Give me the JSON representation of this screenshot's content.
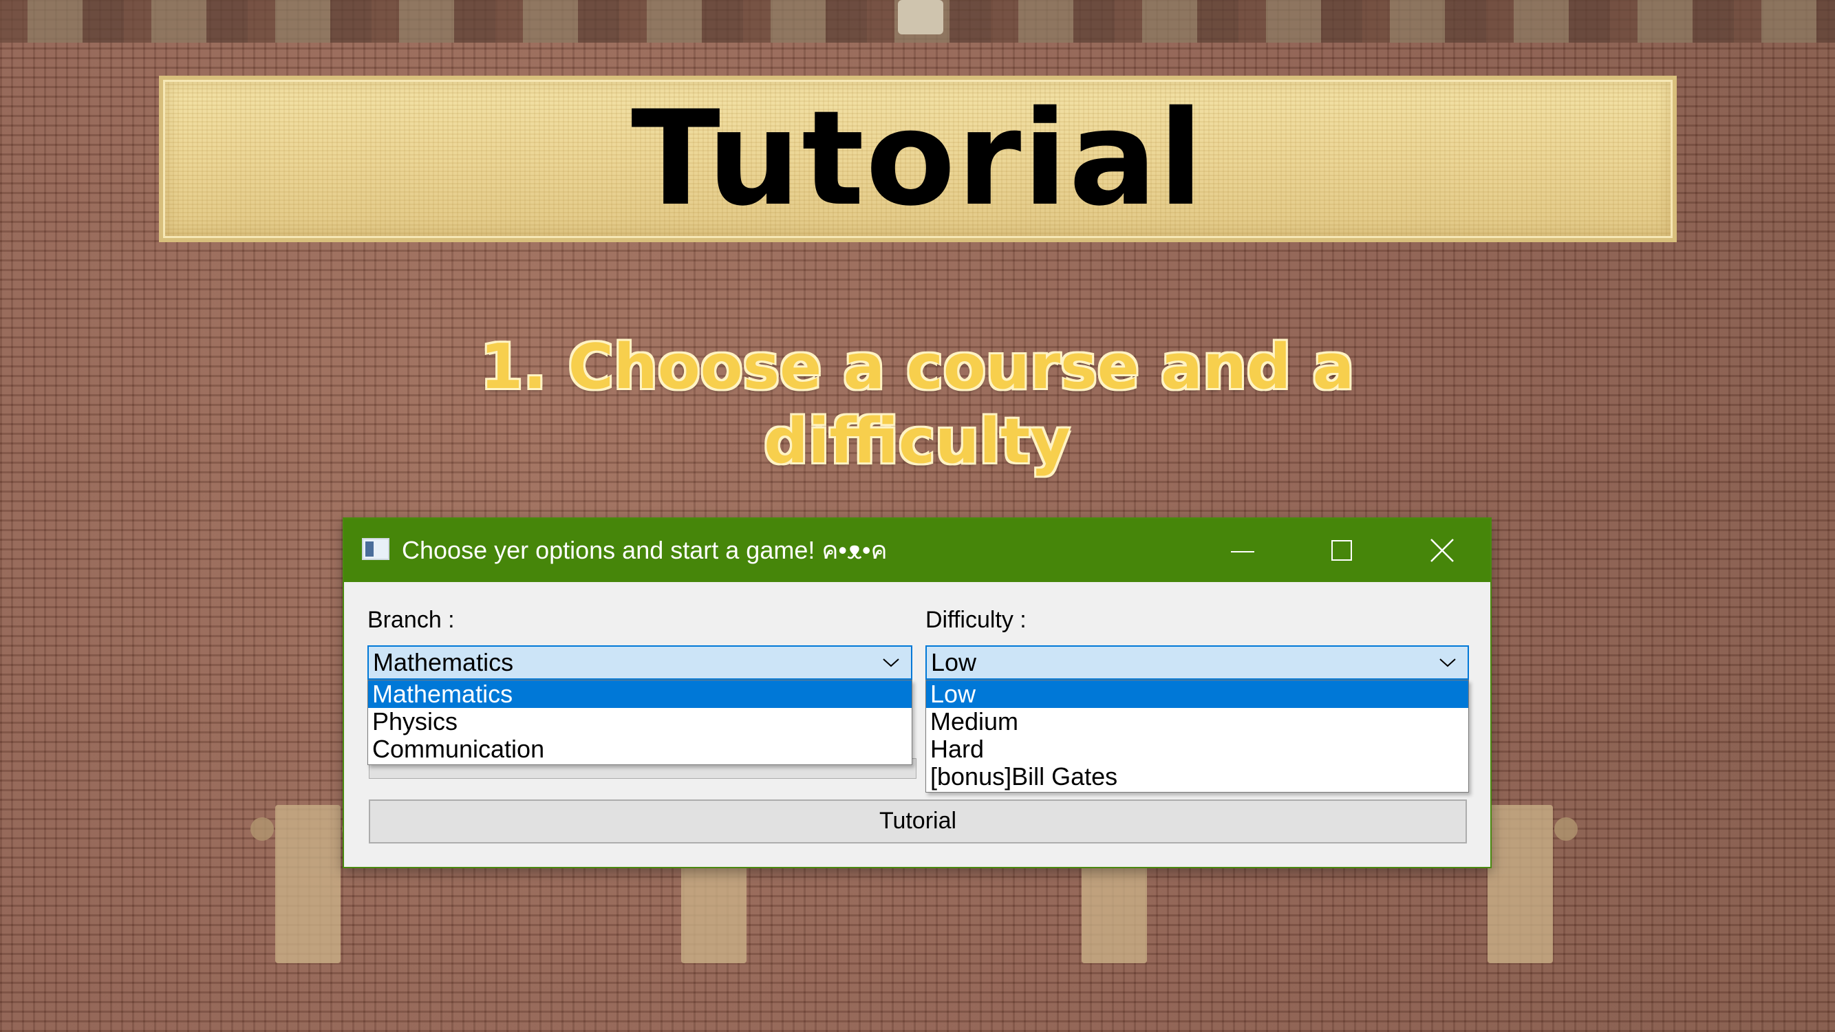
{
  "banner": {
    "title": "Tutorial"
  },
  "subtitle": {
    "line1": "1. Choose a course and a",
    "line2": "difficulty"
  },
  "window": {
    "title": "Choose yer options and start a game! ค•ᴥ•ค",
    "branch": {
      "label": "Branch :",
      "selected": "Mathematics",
      "options": [
        "Mathematics",
        "Physics",
        "Communication"
      ]
    },
    "difficulty": {
      "label": "Difficulty :",
      "selected": "Low",
      "options": [
        "Low",
        "Medium",
        "Hard",
        "[bonus]Bill Gates"
      ]
    },
    "button_label": "Tutorial"
  },
  "colors": {
    "titlebar": "#46860a",
    "selection": "#0078d7",
    "subtitle_text": "#f7cf4d"
  },
  "icons": {
    "app": "window-app-icon",
    "minimize": "minimize-icon",
    "maximize": "maximize-icon",
    "close": "close-icon",
    "dropdown": "chevron-down-icon"
  }
}
